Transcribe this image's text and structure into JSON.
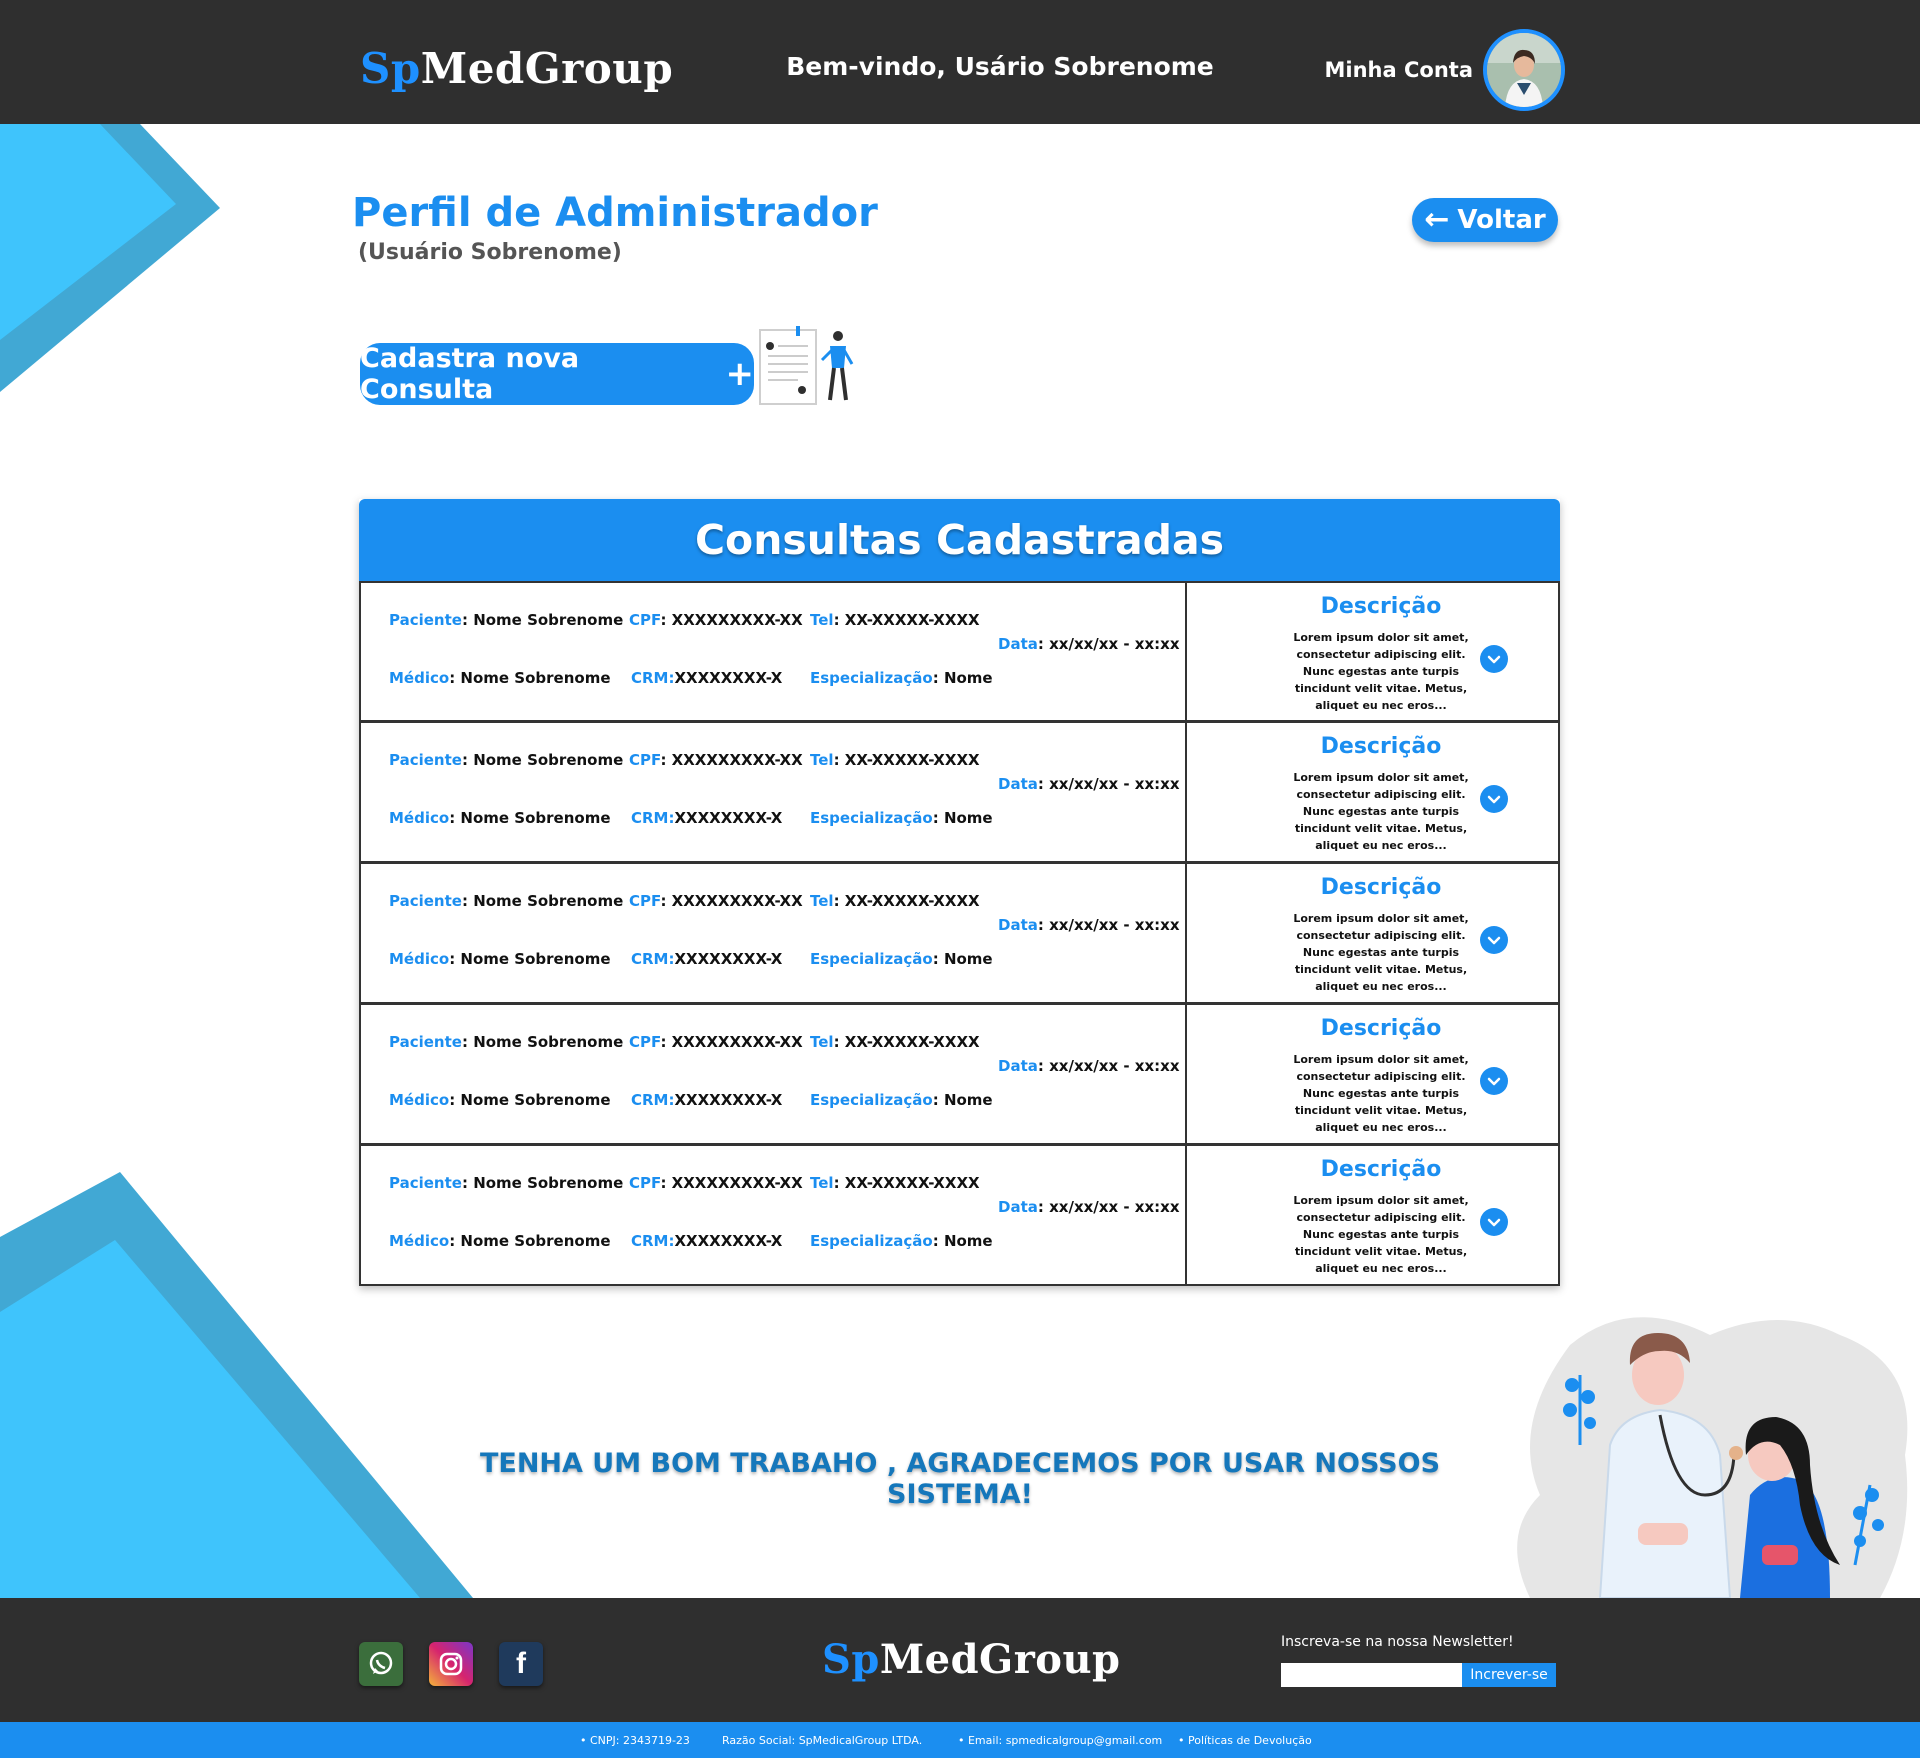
{
  "header": {
    "brand_sp": "Sp",
    "brand_rest": "MedGroup",
    "welcome": "Bem-vindo, Usário Sobrenome",
    "account_label": "Minha Conta"
  },
  "profile": {
    "title": "Perfil de Administrador",
    "subtitle": "(Usuário Sobrenome)",
    "back_label": "Voltar",
    "new_consult_label": "Cadastra nova Consulta"
  },
  "consultas": {
    "title": "Consultas Cadastradas",
    "labels": {
      "paciente": "Paciente",
      "cpf": "CPF",
      "tel": "Tel",
      "medico": "Médico",
      "crm": "CRM:",
      "especializacao": "Especialização",
      "data": "Data",
      "descricao": "Descrição"
    },
    "rows": [
      {
        "paciente": "Nome Sobrenome",
        "cpf": "XXXXXXXXX-XX",
        "tel": "XX-XXXXX-XXXX",
        "medico": "Nome Sobrenome",
        "crm": "XXXXXXXX-X",
        "especializacao": "Nome",
        "data": "xx/xx/xx - xx:xx",
        "descricao": "Lorem ipsum dolor sit amet,\nconsectetur adipiscing elit.\nNunc egestas ante turpis\ntincidunt velit vitae. Metus,\naliquet eu nec eros..."
      },
      {
        "paciente": "Nome Sobrenome",
        "cpf": "XXXXXXXXX-XX",
        "tel": "XX-XXXXX-XXXX",
        "medico": "Nome Sobrenome",
        "crm": "XXXXXXXX-X",
        "especializacao": "Nome",
        "data": "xx/xx/xx - xx:xx",
        "descricao": "Lorem ipsum dolor sit amet,\nconsectetur adipiscing elit.\nNunc egestas ante turpis\ntincidunt velit vitae. Metus,\naliquet eu nec eros..."
      },
      {
        "paciente": "Nome Sobrenome",
        "cpf": "XXXXXXXXX-XX",
        "tel": "XX-XXXXX-XXXX",
        "medico": "Nome Sobrenome",
        "crm": "XXXXXXXX-X",
        "especializacao": "Nome",
        "data": "xx/xx/xx - xx:xx",
        "descricao": "Lorem ipsum dolor sit amet,\nconsectetur adipiscing elit.\nNunc egestas ante turpis\ntincidunt velit vitae. Metus,\naliquet eu nec eros..."
      },
      {
        "paciente": "Nome Sobrenome",
        "cpf": "XXXXXXXXX-XX",
        "tel": "XX-XXXXX-XXXX",
        "medico": "Nome Sobrenome",
        "crm": "XXXXXXXX-X",
        "especializacao": "Nome",
        "data": "xx/xx/xx - xx:xx",
        "descricao": "Lorem ipsum dolor sit amet,\nconsectetur adipiscing elit.\nNunc egestas ante turpis\ntincidunt velit vitae. Metus,\naliquet eu nec eros..."
      },
      {
        "paciente": "Nome Sobrenome",
        "cpf": "XXXXXXXXX-XX",
        "tel": "XX-XXXXX-XXXX",
        "medico": "Nome Sobrenome",
        "crm": "XXXXXXXX-X",
        "especializacao": "Nome",
        "data": "xx/xx/xx - xx:xx",
        "descricao": "Lorem ipsum dolor sit amet,\nconsectetur adipiscing elit.\nNunc egestas ante turpis\ntincidunt velit vitae. Metus,\naliquet eu nec eros..."
      }
    ]
  },
  "thanks": "TENHA UM BOM  TRABAHO , AGRADECEMOS POR USAR NOSSOS SISTEMA!",
  "footer": {
    "brand_sp": "Sp",
    "brand_rest": "MedGroup",
    "social_icons": [
      "whatsapp-icon",
      "instagram-icon",
      "facebook-icon"
    ],
    "newsletter_label": "Inscreva-se na nossa Newsletter!",
    "newsletter_placeholder": "",
    "newsletter_button": "Increver-se",
    "bottom": {
      "cnpj": "• CNPJ: 2343719-23",
      "razao": "Razão Social: SpMedicalGroup LTDA.",
      "email": "• Email: spmedicalgroup@gmail.com",
      "politicas": "• Políticas de Devolução"
    }
  },
  "colors": {
    "accent": "#1b8ef0",
    "dark": "#2f2f2f",
    "deco_light": "#3fc4fc",
    "deco_dark": "#41a8d4"
  }
}
